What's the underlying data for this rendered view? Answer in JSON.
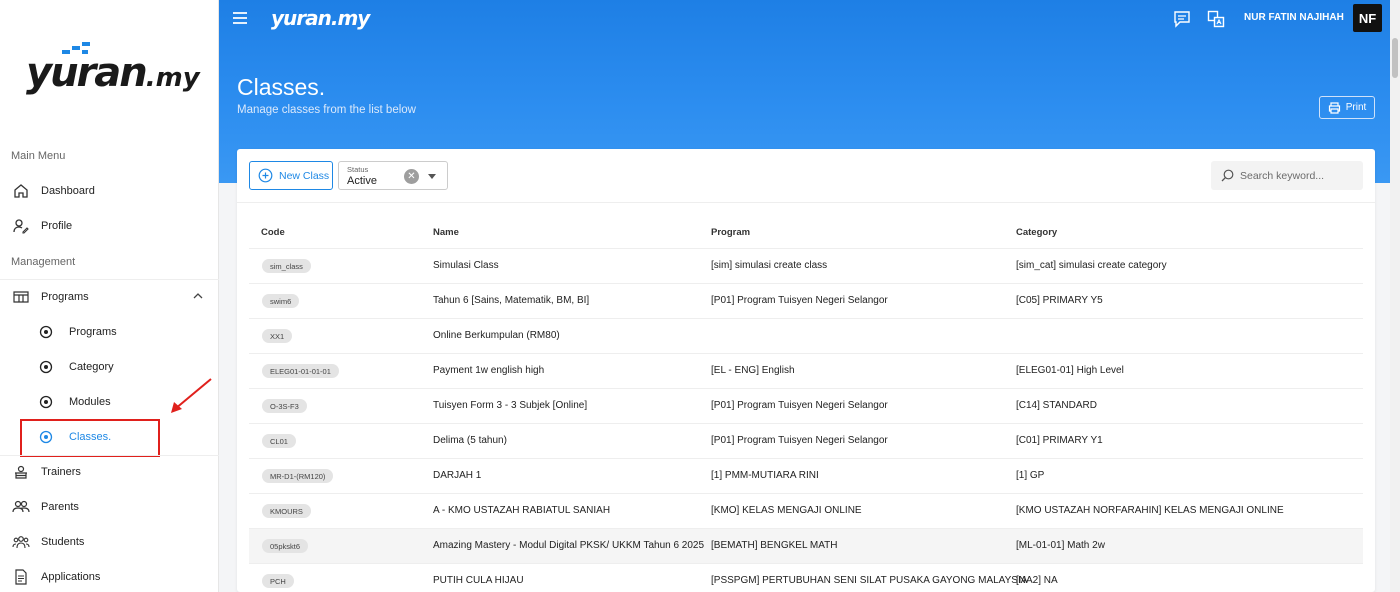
{
  "sidebar": {
    "logo": "yuran.my",
    "sections": {
      "main": "Main Menu",
      "management": "Management"
    },
    "items": [
      {
        "label": "Dashboard"
      },
      {
        "label": "Profile"
      },
      {
        "label": "Programs"
      },
      {
        "label": "Programs"
      },
      {
        "label": "Category"
      },
      {
        "label": "Modules"
      },
      {
        "label": "Classes."
      },
      {
        "label": "Trainers"
      },
      {
        "label": "Parents"
      },
      {
        "label": "Students"
      },
      {
        "label": "Applications"
      }
    ]
  },
  "header": {
    "brand": "yuran.my",
    "user_name": "NUR FATIN NAJIHAH",
    "avatar_initials": "NF",
    "title": "Classes.",
    "subtitle": "Manage classes from the list below",
    "print_label": "Print"
  },
  "toolbar": {
    "new_class_label": "New Class",
    "status_label": "Status",
    "status_value": "Active",
    "search_placeholder": "Search keyword..."
  },
  "table": {
    "columns": [
      "Code",
      "Name",
      "Program",
      "Category"
    ],
    "rows": [
      {
        "code": "sim_class",
        "name": "Simulasi Class",
        "program": "[sim] simulasi create class",
        "category": "[sim_cat] simulasi create category"
      },
      {
        "code": "swim6",
        "name": "Tahun 6 [Sains, Matematik, BM, BI]",
        "program": "[P01] Program Tuisyen Negeri Selangor",
        "category": "[C05] PRIMARY Y5"
      },
      {
        "code": "XX1",
        "name": "Online Berkumpulan (RM80)",
        "program": "",
        "category": ""
      },
      {
        "code": "ELEG01-01-01-01",
        "name": "Payment 1w english high",
        "program": "[EL - ENG] English",
        "category": "[ELEG01-01] High Level"
      },
      {
        "code": "O-3S-F3",
        "name": "Tuisyen Form 3 - 3 Subjek [Online]",
        "program": "[P01] Program Tuisyen Negeri Selangor",
        "category": "[C14] STANDARD"
      },
      {
        "code": "CL01",
        "name": "Delima (5 tahun)",
        "program": "[P01] Program Tuisyen Negeri Selangor",
        "category": "[C01] PRIMARY Y1"
      },
      {
        "code": "MR-D1-(RM120)",
        "name": "DARJAH 1",
        "program": "[1] PMM-MUTIARA RINI",
        "category": "[1] GP"
      },
      {
        "code": "KMOURS",
        "name": "A - KMO USTAZAH RABIATUL SANIAH",
        "program": "[KMO] KELAS MENGAJI ONLINE",
        "category": "[KMO USTAZAH NORFARAHIN] KELAS MENGAJI ONLINE"
      },
      {
        "code": "05pkskt6",
        "name": "Amazing Mastery - Modul Digital PKSK/ UKKM Tahun 6 2025",
        "program": "[BEMATH] BENGKEL MATH",
        "category": "[ML-01-01] Math 2w"
      },
      {
        "code": "PCH",
        "name": "PUTIH CULA HIJAU",
        "program": "[PSSPGM] PERTUBUHAN SENI SILAT PUSAKA GAYONG MALAYSIA",
        "category": "[NA2] NA"
      }
    ]
  }
}
